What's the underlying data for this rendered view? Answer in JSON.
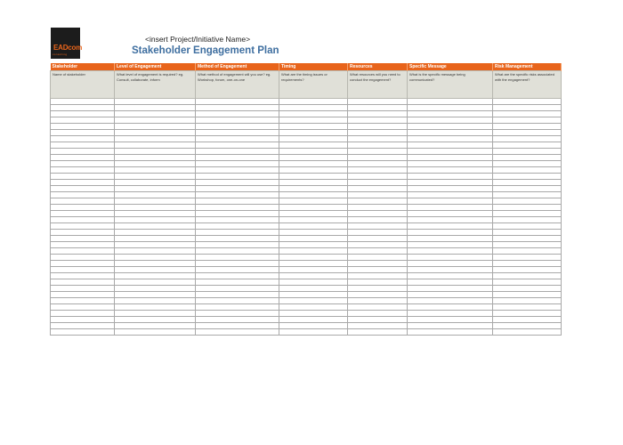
{
  "logo": {
    "main": "EADcom",
    "sub": "consulting"
  },
  "header": {
    "project_name": "<insert Project/Initiative Name>",
    "title": "Stakeholder Engagement Plan"
  },
  "table": {
    "columns": [
      {
        "label": "Stakeholder",
        "description": "Name of stakeholder"
      },
      {
        "label": "Level of Engagement",
        "description": "What level of engagement is required? eg. Consult, collaborate, inform"
      },
      {
        "label": "Method of Engagement",
        "description": "What method of engagement will you use? eg. Workshop, forum, one-on-one"
      },
      {
        "label": "Timing",
        "description": "What are the timing issues or requirements?"
      },
      {
        "label": "Resources",
        "description": "What resources will you need to conduct the engagement?"
      },
      {
        "label": "Specific Message",
        "description": "What is the specific message being communicated?"
      },
      {
        "label": "Risk Management",
        "description": "What are the specific risks associated with the engagement?"
      }
    ],
    "empty_row_count": 38
  },
  "colors": {
    "header_bg": "#e8641b",
    "title": "#3f6fa0",
    "desc_bg": "#e0e0d8"
  }
}
